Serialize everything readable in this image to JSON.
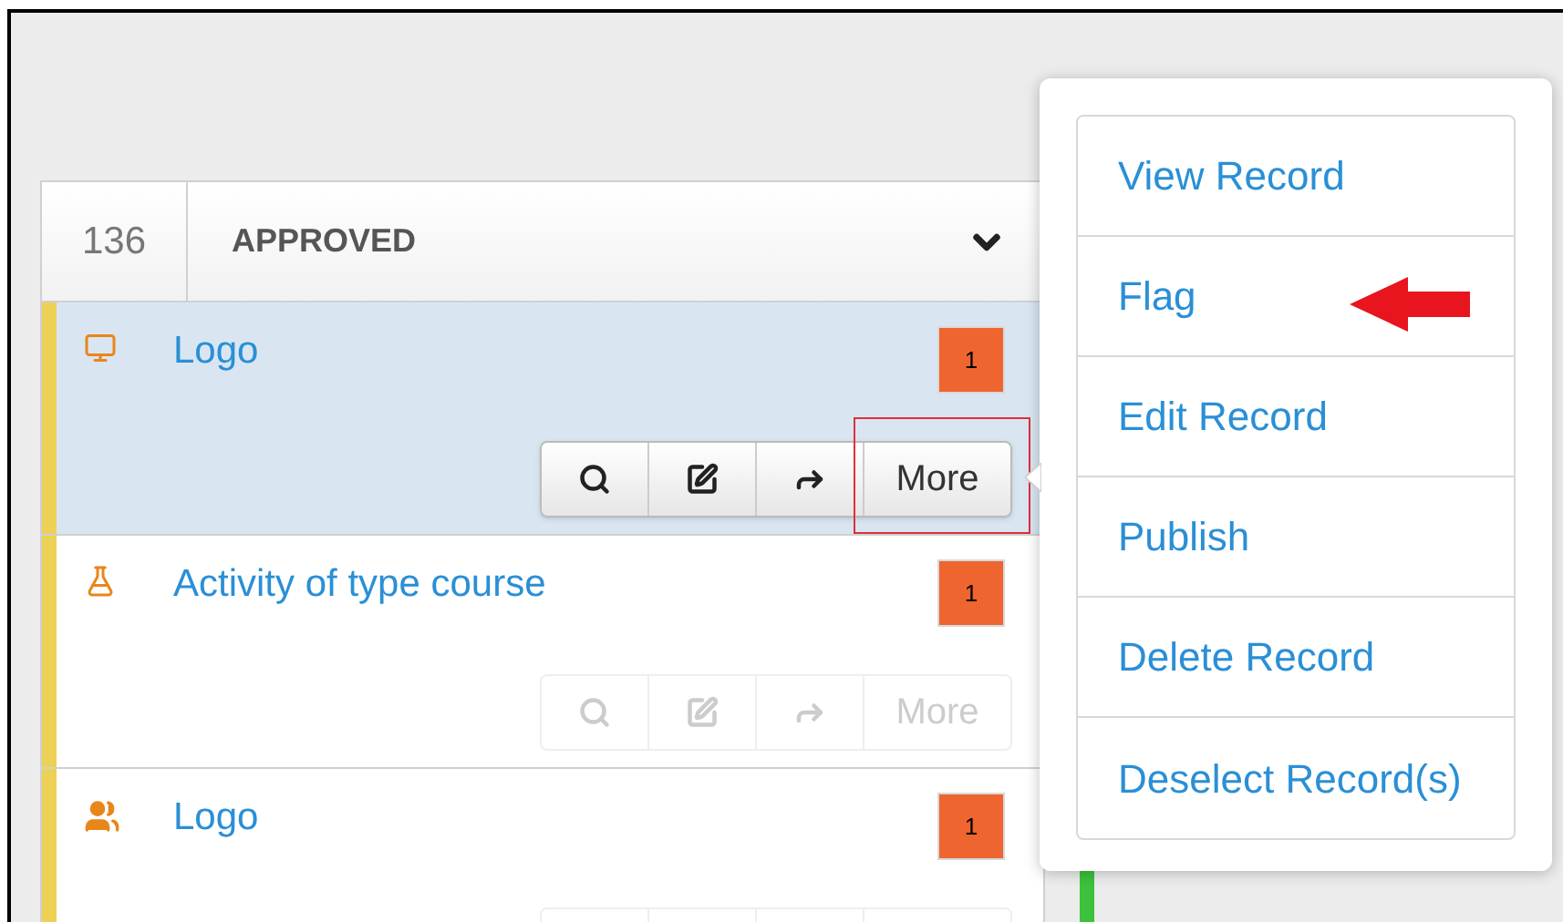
{
  "column": {
    "count": "136",
    "title": "APPROVED"
  },
  "records": [
    {
      "kind": "device",
      "title": "Logo",
      "badge": "1",
      "selected": true,
      "disabled": false,
      "more_label": "More"
    },
    {
      "kind": "flask",
      "title": "Activity of type course",
      "badge": "1",
      "selected": false,
      "disabled": true,
      "more_label": "More"
    },
    {
      "kind": "people",
      "title": "Logo",
      "badge": "1",
      "selected": false,
      "disabled": true
    }
  ],
  "menu": {
    "items": [
      "View Record",
      "Flag",
      "Edit Record",
      "Publish",
      "Delete Record",
      "Deselect Record(s)"
    ]
  }
}
